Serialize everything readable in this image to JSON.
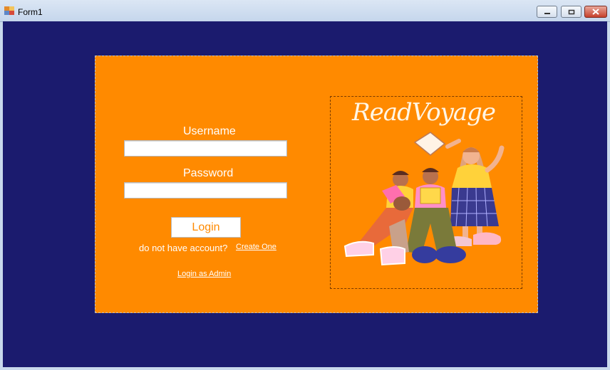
{
  "window": {
    "title": "Form1"
  },
  "login": {
    "username_label": "Username",
    "password_label": "Password",
    "username_value": "",
    "password_value": "",
    "login_button": "Login",
    "no_account_text": "do not have account?",
    "create_link": "Create One",
    "admin_link": "Login as Admin"
  },
  "brand": {
    "name": "ReadVoyage"
  },
  "colors": {
    "background": "#1b1b6e",
    "panel": "#ff8a00",
    "text": "#ffffff"
  },
  "icons": {
    "illustration": "people-reading-books-illustration"
  }
}
